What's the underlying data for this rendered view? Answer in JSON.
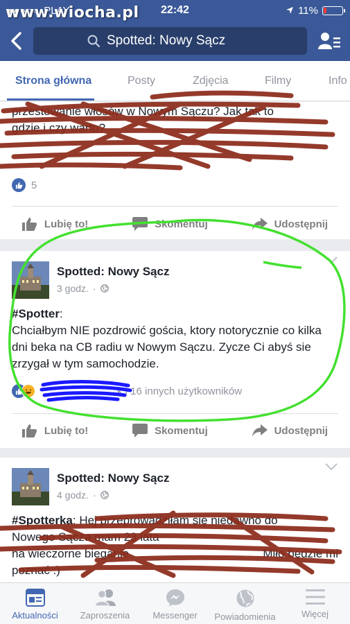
{
  "status_bar": {
    "carrier": "PLAY",
    "time": "22:42",
    "battery": "11%",
    "watermark": "www.wiocha.pl"
  },
  "header": {
    "search_text": "Spotted: Nowy Sącz",
    "icons": [
      "back-arrow-icon",
      "search-icon",
      "profile-list-icon"
    ]
  },
  "tabs": [
    {
      "label": "Strona główna",
      "active": true
    },
    {
      "label": "Posty",
      "active": false
    },
    {
      "label": "Zdjęcia",
      "active": false
    },
    {
      "label": "Filmy",
      "active": false
    },
    {
      "label": "Info",
      "active": false
    }
  ],
  "post1": {
    "visible_lines": [
      "przestowanie włosów w Nowym Sączu? Jak tak to",
      "gdzie i czy warto?",
      "",
      ""
    ],
    "like_count": "5"
  },
  "actions": {
    "like": "Lubię to!",
    "comment": "Skomentuj",
    "share": "Udostępnij"
  },
  "post2": {
    "author": "Spotted: Nowy Sącz",
    "time": "3 godz.",
    "hashtag": "#Spotter",
    "text_after_hashtag": ":",
    "body": "Chciałbym NIE pozdrowić gościa, ktory notorycznie co kilka dni beka na CB radiu w Nowym Sączu. Zycze Ci abyś sie zrzygał w tym samochodzie.",
    "reactions_text": "k i 16 innych użytkowników"
  },
  "post3": {
    "author": "Spotted: Nowy Sącz",
    "time": "4 godz.",
    "hashtag": "#Spotterka",
    "line1_rest": ": Hej przeprowadziłam się niedawno do",
    "line2": "Nowego Sącza mam 23 lata",
    "line3": "na wieczorne bieganie",
    "line3_end": "Miło będzie mi",
    "line4": "poznać :)"
  },
  "bottom_nav": [
    {
      "label": "Aktualności",
      "icon": "news-feed-icon",
      "active": true
    },
    {
      "label": "Zaproszenia",
      "icon": "friend-requests-icon",
      "active": false
    },
    {
      "label": "Messenger",
      "icon": "messenger-icon",
      "active": false
    },
    {
      "label": "Powiadomienia",
      "icon": "globe-icon",
      "active": false
    },
    {
      "label": "Więcej",
      "icon": "menu-icon",
      "active": false
    }
  ],
  "colors": {
    "facebook_blue": "#3b5998",
    "tab_active": "#4267b2",
    "scribble_red": "#8b2a1a",
    "highlight_green": "#44e030",
    "scribble_blue": "#1a1aff"
  }
}
